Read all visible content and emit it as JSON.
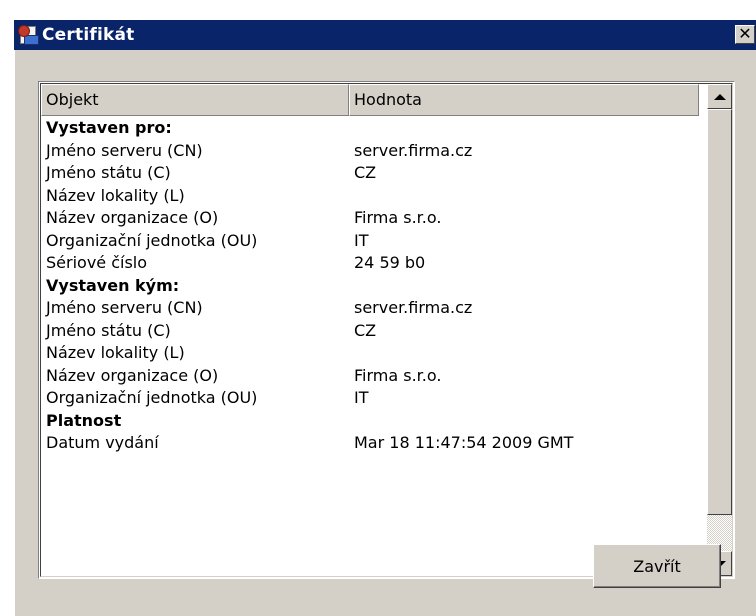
{
  "window": {
    "title": "Certifikát"
  },
  "list": {
    "columns": [
      "Objekt",
      "Hodnota"
    ],
    "rows": [
      {
        "key": "Vystaven pro:",
        "value": "",
        "section": true
      },
      {
        "key": "Jméno serveru (CN)",
        "value": "server.firma.cz"
      },
      {
        "key": "Jméno státu (C)",
        "value": "CZ"
      },
      {
        "key": "Název lokality (L)",
        "value": ""
      },
      {
        "key": "Název organizace (O)",
        "value": "Firma s.r.o."
      },
      {
        "key": "Organizační jednotka (OU)",
        "value": "IT"
      },
      {
        "key": "Sériové číslo",
        "value": "24 59 b0"
      },
      {
        "key": "Vystaven kým:",
        "value": "",
        "section": true
      },
      {
        "key": "Jméno serveru (CN)",
        "value": "server.firma.cz"
      },
      {
        "key": "Jméno státu (C)",
        "value": "CZ"
      },
      {
        "key": "Název lokality (L)",
        "value": ""
      },
      {
        "key": "Název organizace (O)",
        "value": "Firma s.r.o."
      },
      {
        "key": "Organizační jednotka (OU)",
        "value": "IT"
      },
      {
        "key": "Platnost",
        "value": "",
        "section": true
      },
      {
        "key": "Datum vydání",
        "value": "Mar 18 11:47:54 2009 GMT"
      }
    ]
  },
  "buttons": {
    "close_label": "Zavřít",
    "title_close_glyph": "✕"
  },
  "icons": {
    "title": "certificate-icon",
    "scroll_up": "arrow-up-icon",
    "scroll_down": "arrow-down-icon"
  },
  "colors": {
    "titlebar": "#0a246a",
    "face": "#d4d0c8"
  }
}
